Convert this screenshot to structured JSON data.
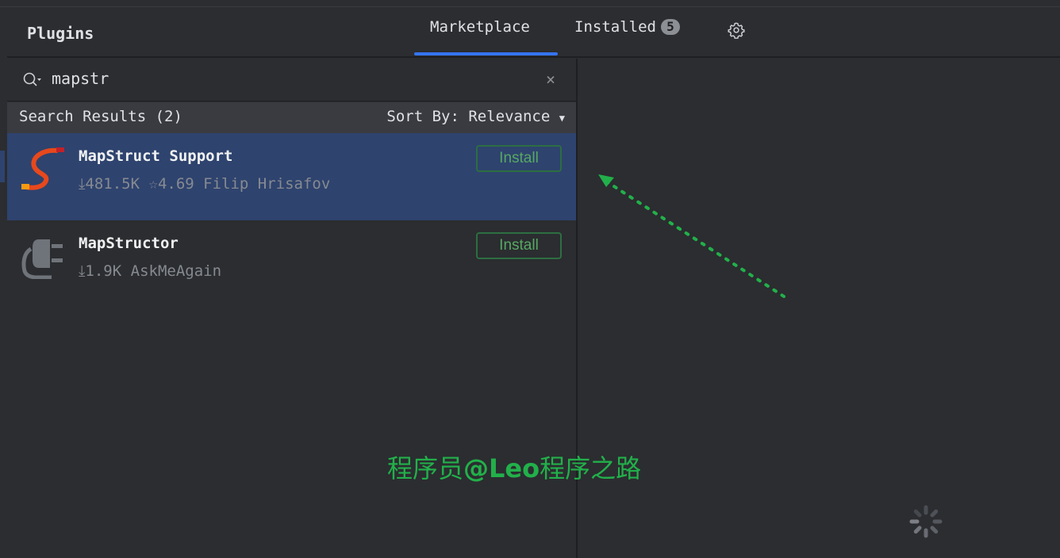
{
  "header": {
    "title": "Plugins",
    "tabs": [
      {
        "label": "Marketplace",
        "active": true
      },
      {
        "label": "Installed",
        "badge": "5"
      }
    ],
    "settings_icon": "gear-icon"
  },
  "search": {
    "value": "mapstr",
    "icon": "search-icon",
    "clear_icon": "close-icon"
  },
  "results": {
    "label": "Search Results (2)",
    "sort": "Sort By: Relevance"
  },
  "plugins": [
    {
      "name": "MapStruct Support",
      "downloads": "481.5K",
      "rating": "4.69",
      "vendor": "Filip Hrisafov",
      "button": "Install",
      "selected": true
    },
    {
      "name": "MapStructor",
      "downloads": "1.9K",
      "vendor": "AskMeAgain",
      "button": "Install",
      "selected": false
    }
  ],
  "watermark": {
    "prefix": "程序员",
    "handle": "@Leo",
    "suffix": "程序之路"
  },
  "colors": {
    "accent": "#3574f0",
    "install": "#57a863",
    "selection": "#2e436e",
    "annotation": "#22b04a"
  }
}
